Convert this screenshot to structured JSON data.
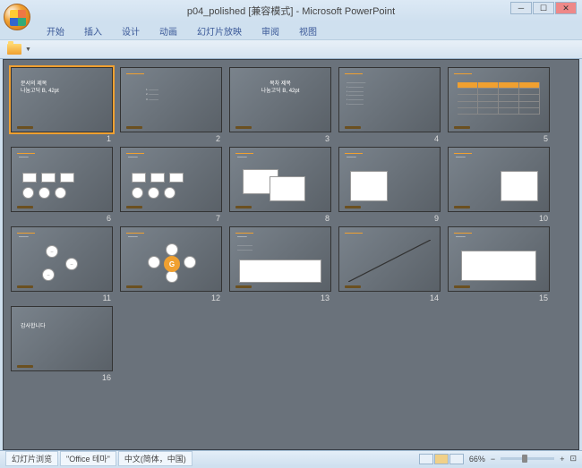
{
  "title": "p04_polished [兼容模式] - Microsoft PowerPoint",
  "tabs": [
    "开始",
    "插入",
    "设计",
    "动画",
    "幻灯片放映",
    "审阅",
    "视图"
  ],
  "slides": [
    {
      "n": "1",
      "title": "문서의 제목\n나눔고딕 B, 42pt"
    },
    {
      "n": "2",
      "title": ""
    },
    {
      "n": "3",
      "title": "목차 제목\n나눔고딕 B, 42pt"
    },
    {
      "n": "4",
      "title": ""
    },
    {
      "n": "5",
      "title": ""
    },
    {
      "n": "6",
      "title": ""
    },
    {
      "n": "7",
      "title": ""
    },
    {
      "n": "8",
      "title": ""
    },
    {
      "n": "9",
      "title": ""
    },
    {
      "n": "10",
      "title": ""
    },
    {
      "n": "11",
      "title": ""
    },
    {
      "n": "12",
      "title": ""
    },
    {
      "n": "13",
      "title": ""
    },
    {
      "n": "14",
      "title": ""
    },
    {
      "n": "15",
      "title": ""
    },
    {
      "n": "16",
      "title": "감사합니다"
    }
  ],
  "status": {
    "left": [
      "幻灯片浏览",
      "\"Office 테마\"",
      "中文(简体，中国)"
    ],
    "zoom": "66%"
  }
}
